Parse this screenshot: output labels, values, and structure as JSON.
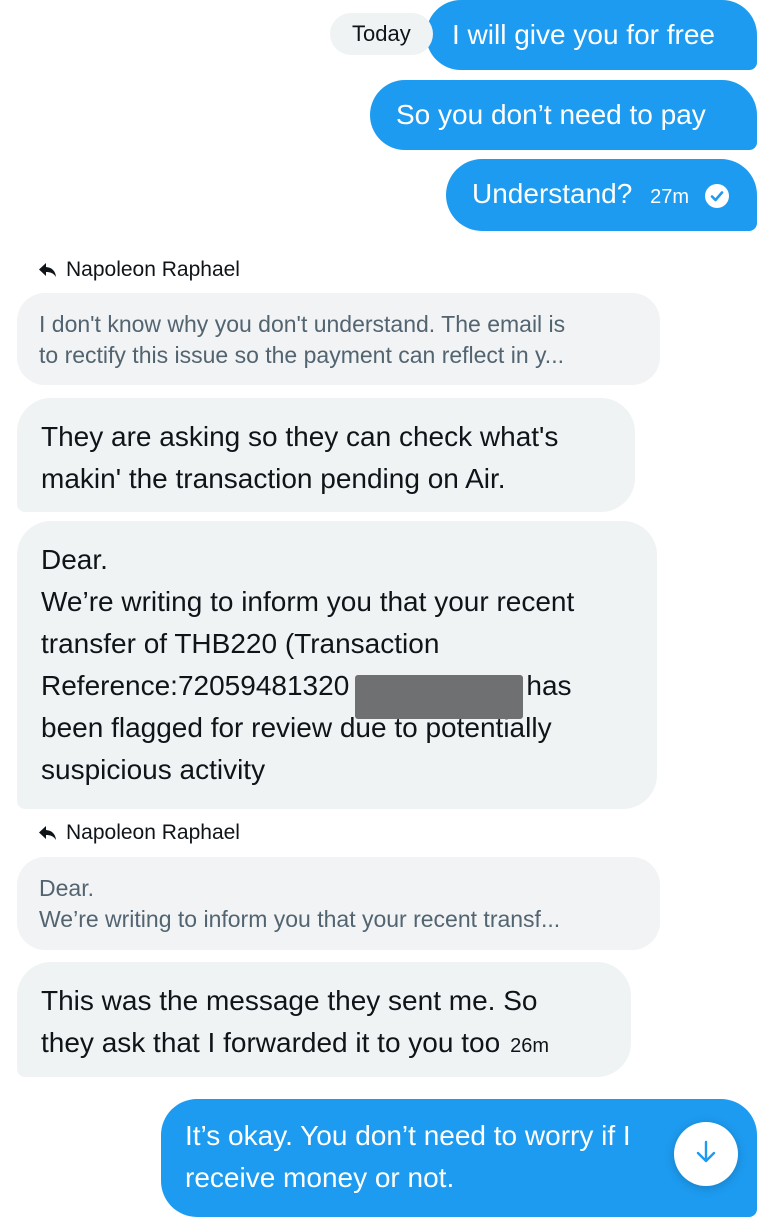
{
  "date_separator": "Today",
  "colors": {
    "sent_bubble": "#1d9bf0",
    "received_bubble": "#eff3f4",
    "quote_text": "#536471"
  },
  "messages": [
    {
      "direction": "sent",
      "lines": [
        "I will give you for free"
      ]
    },
    {
      "direction": "sent",
      "lines": [
        "So you don’t need to pay"
      ]
    },
    {
      "direction": "sent",
      "lines": [
        "Understand?"
      ],
      "time": "27m",
      "status_icon": "read-check-icon"
    },
    {
      "direction": "received",
      "reply_to": {
        "name": "Napoleon Raphael",
        "icon": "reply-arrow-icon",
        "quote_lines": [
          "I don't know why you don't understand. The email is",
          "to rectify this issue so the payment can reflect in y..."
        ]
      },
      "lines": [
        "They are asking so they can check what's",
        "makin' the transaction pending on Air."
      ]
    },
    {
      "direction": "received",
      "lines": [
        "Dear.",
        "We’re writing to inform you that your recent",
        "transfer of THB220 (Transaction",
        "Reference:72059481320",
        "been flagged for review due to potentially",
        "suspicious activity"
      ],
      "line4_suffix": ") has",
      "redacted": true
    },
    {
      "direction": "received",
      "reply_to": {
        "name": "Napoleon Raphael",
        "icon": "reply-arrow-icon",
        "quote_lines": [
          "Dear.",
          "We’re writing to inform you that your recent transf..."
        ]
      },
      "lines": [
        "This was the message they sent me. So",
        "they ask that I forwarded it to you too"
      ],
      "time": "26m"
    },
    {
      "direction": "sent",
      "lines": [
        "It’s okay. You don’t need to worry if I",
        "receive money or not."
      ]
    }
  ],
  "scroll_button": {
    "icon": "arrow-down-icon"
  }
}
